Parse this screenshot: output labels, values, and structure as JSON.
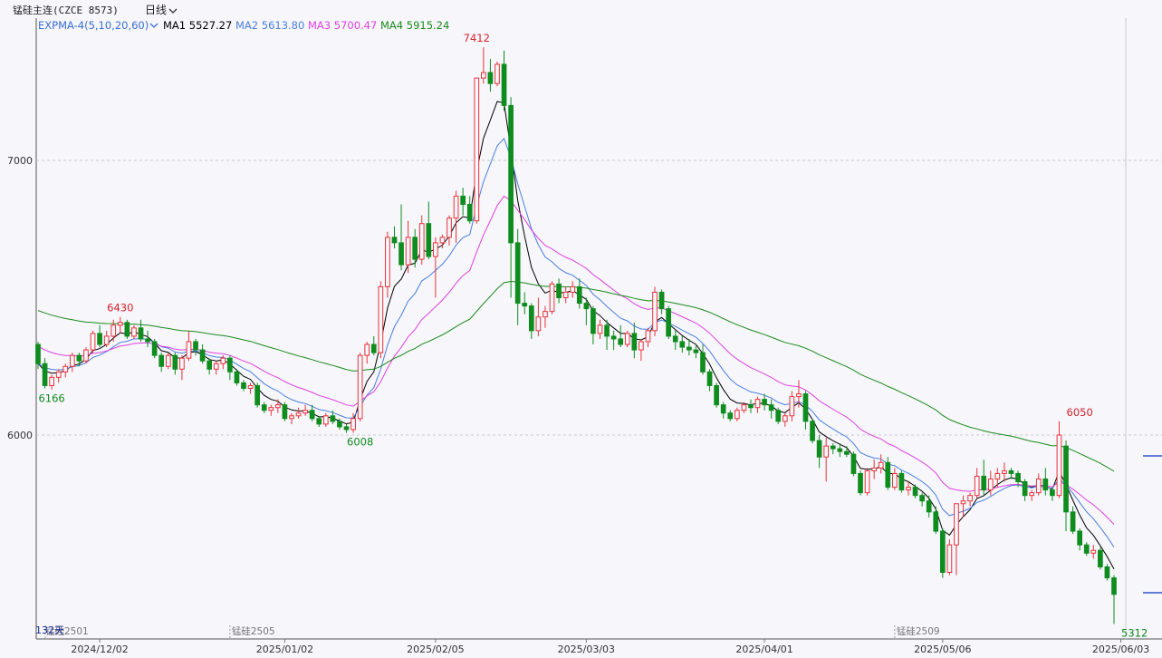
{
  "header": {
    "title": "锰硅主连(CZCE  8573)",
    "period_label": "日线",
    "chevron": "chevron-down-icon"
  },
  "legend": {
    "indicator": "EXPMA-4(5,10,20,60)",
    "ma1": "MA1 5527.27",
    "ma2": "MA2 5613.80",
    "ma3": "MA3 5700.47",
    "ma4": "MA4 5915.24"
  },
  "colors": {
    "background": "#f6f6fb",
    "up": "#e8333a",
    "down": "#0f8c1e",
    "ma1": "#000000",
    "ma2": "#4a7fe0",
    "ma3": "#e040e0",
    "ma4": "#1a8a1a",
    "grid": "#c8c8d0"
  },
  "chart_data": {
    "type": "candlestick",
    "y_ticks": [
      "7000",
      "6000"
    ],
    "y_tick_values": [
      7000,
      6000
    ],
    "ylim": [
      5260,
      7580
    ],
    "x_labels": [
      "2024/12/02",
      "2025/01/02",
      "2025/02/05",
      "2025/03/03",
      "2025/04/01",
      "2025/05/06",
      "2025/06/03"
    ],
    "x_label_index": [
      9,
      36,
      58,
      80,
      106,
      132,
      158
    ],
    "contract_labels": [
      "锰硅2501",
      "锰硅2505",
      "锰硅2509"
    ],
    "contract_label_index": [
      0,
      28,
      125
    ],
    "day_count": "132天",
    "annotations": [
      {
        "text": "6430",
        "index": 12,
        "value": 6430,
        "kind": "high"
      },
      {
        "text": "6166",
        "index": 2,
        "value": 6166,
        "kind": "low"
      },
      {
        "text": "6008",
        "index": 47,
        "value": 6008,
        "kind": "low"
      },
      {
        "text": "7412",
        "index": 64,
        "value": 7412,
        "kind": "high"
      },
      {
        "text": "6050",
        "index": 152,
        "value": 6050,
        "kind": "high"
      },
      {
        "text": "5312",
        "index": 160,
        "value": 5312,
        "kind": "low"
      }
    ],
    "ohlc": [
      [
        6330,
        6340,
        6240,
        6260
      ],
      [
        6260,
        6280,
        6170,
        6180
      ],
      [
        6180,
        6220,
        6166,
        6210
      ],
      [
        6210,
        6240,
        6190,
        6230
      ],
      [
        6230,
        6260,
        6210,
        6250
      ],
      [
        6250,
        6300,
        6230,
        6290
      ],
      [
        6290,
        6300,
        6250,
        6270
      ],
      [
        6270,
        6320,
        6260,
        6310
      ],
      [
        6310,
        6380,
        6300,
        6370
      ],
      [
        6370,
        6400,
        6320,
        6330
      ],
      [
        6330,
        6380,
        6320,
        6360
      ],
      [
        6360,
        6420,
        6340,
        6400
      ],
      [
        6400,
        6430,
        6370,
        6410
      ],
      [
        6410,
        6420,
        6350,
        6360
      ],
      [
        6360,
        6400,
        6350,
        6390
      ],
      [
        6390,
        6420,
        6340,
        6350
      ],
      [
        6350,
        6380,
        6320,
        6340
      ],
      [
        6340,
        6350,
        6280,
        6290
      ],
      [
        6290,
        6300,
        6230,
        6250
      ],
      [
        6250,
        6300,
        6240,
        6290
      ],
      [
        6290,
        6300,
        6220,
        6240
      ],
      [
        6240,
        6290,
        6200,
        6280
      ],
      [
        6280,
        6380,
        6270,
        6340
      ],
      [
        6340,
        6350,
        6290,
        6310
      ],
      [
        6310,
        6330,
        6260,
        6270
      ],
      [
        6270,
        6280,
        6220,
        6240
      ],
      [
        6240,
        6270,
        6220,
        6260
      ],
      [
        6260,
        6290,
        6240,
        6280
      ],
      [
        6280,
        6290,
        6200,
        6230
      ],
      [
        6230,
        6240,
        6180,
        6190
      ],
      [
        6190,
        6200,
        6160,
        6170
      ],
      [
        6170,
        6190,
        6150,
        6180
      ],
      [
        6180,
        6190,
        6100,
        6110
      ],
      [
        6110,
        6120,
        6080,
        6090
      ],
      [
        6090,
        6110,
        6070,
        6100
      ],
      [
        6100,
        6130,
        6080,
        6110
      ],
      [
        6110,
        6120,
        6050,
        6060
      ],
      [
        6060,
        6080,
        6040,
        6070
      ],
      [
        6070,
        6100,
        6060,
        6080
      ],
      [
        6080,
        6110,
        6070,
        6090
      ],
      [
        6090,
        6110,
        6050,
        6060
      ],
      [
        6060,
        6070,
        6030,
        6040
      ],
      [
        6040,
        6080,
        6030,
        6070
      ],
      [
        6070,
        6090,
        6040,
        6050
      ],
      [
        6050,
        6060,
        6020,
        6030
      ],
      [
        6030,
        6040,
        6008,
        6020
      ],
      [
        6020,
        6080,
        6008,
        6060
      ],
      [
        6060,
        6300,
        6050,
        6290
      ],
      [
        6290,
        6340,
        6260,
        6330
      ],
      [
        6330,
        6360,
        6290,
        6300
      ],
      [
        6300,
        6560,
        6280,
        6540
      ],
      [
        6540,
        6740,
        6500,
        6720
      ],
      [
        6720,
        6760,
        6680,
        6700
      ],
      [
        6700,
        6840,
        6600,
        6620
      ],
      [
        6620,
        6780,
        6590,
        6720
      ],
      [
        6720,
        6750,
        6610,
        6640
      ],
      [
        6640,
        6800,
        6620,
        6770
      ],
      [
        6770,
        6850,
        6640,
        6650
      ],
      [
        6650,
        6720,
        6500,
        6700
      ],
      [
        6700,
        6730,
        6680,
        6720
      ],
      [
        6720,
        6800,
        6690,
        6790
      ],
      [
        6790,
        6890,
        6700,
        6870
      ],
      [
        6870,
        6900,
        6800,
        6840
      ],
      [
        6840,
        6870,
        6770,
        6780
      ],
      [
        6780,
        7300,
        6770,
        7300
      ],
      [
        7300,
        7412,
        7280,
        7320
      ],
      [
        7320,
        7370,
        7250,
        7280
      ],
      [
        7280,
        7360,
        7270,
        7350
      ],
      [
        7350,
        7400,
        7180,
        7200
      ],
      [
        7200,
        7230,
        6500,
        6700
      ],
      [
        6700,
        6750,
        6400,
        6480
      ],
      [
        6480,
        6520,
        6440,
        6470
      ],
      [
        6470,
        6480,
        6350,
        6380
      ],
      [
        6380,
        6500,
        6360,
        6430
      ],
      [
        6430,
        6470,
        6390,
        6450
      ],
      [
        6450,
        6560,
        6440,
        6550
      ],
      [
        6550,
        6570,
        6480,
        6500
      ],
      [
        6500,
        6540,
        6480,
        6520
      ],
      [
        6520,
        6560,
        6500,
        6540
      ],
      [
        6540,
        6570,
        6460,
        6480
      ],
      [
        6480,
        6500,
        6400,
        6460
      ],
      [
        6460,
        6470,
        6330,
        6370
      ],
      [
        6370,
        6420,
        6350,
        6400
      ],
      [
        6400,
        6420,
        6310,
        6360
      ],
      [
        6360,
        6380,
        6310,
        6350
      ],
      [
        6350,
        6400,
        6320,
        6330
      ],
      [
        6330,
        6380,
        6320,
        6370
      ],
      [
        6370,
        6410,
        6280,
        6310
      ],
      [
        6310,
        6350,
        6270,
        6340
      ],
      [
        6340,
        6390,
        6320,
        6380
      ],
      [
        6380,
        6540,
        6360,
        6520
      ],
      [
        6520,
        6530,
        6440,
        6460
      ],
      [
        6460,
        6470,
        6350,
        6360
      ],
      [
        6360,
        6380,
        6310,
        6340
      ],
      [
        6340,
        6360,
        6300,
        6320
      ],
      [
        6320,
        6350,
        6290,
        6310
      ],
      [
        6310,
        6330,
        6280,
        6300
      ],
      [
        6300,
        6330,
        6220,
        6230
      ],
      [
        6230,
        6240,
        6160,
        6180
      ],
      [
        6180,
        6190,
        6100,
        6110
      ],
      [
        6110,
        6120,
        6060,
        6080
      ],
      [
        6080,
        6090,
        6050,
        6060
      ],
      [
        6060,
        6100,
        6050,
        6090
      ],
      [
        6090,
        6120,
        6080,
        6110
      ],
      [
        6110,
        6130,
        6080,
        6100
      ],
      [
        6100,
        6140,
        6080,
        6130
      ],
      [
        6130,
        6150,
        6090,
        6110
      ],
      [
        6110,
        6130,
        6060,
        6090
      ],
      [
        6090,
        6100,
        6040,
        6050
      ],
      [
        6050,
        6080,
        6030,
        6070
      ],
      [
        6070,
        6160,
        6050,
        6140
      ],
      [
        6140,
        6200,
        6100,
        6150
      ],
      [
        6150,
        6160,
        6020,
        6050
      ],
      [
        6050,
        6060,
        5970,
        5980
      ],
      [
        5980,
        6000,
        5880,
        5920
      ],
      [
        5920,
        5990,
        5830,
        5960
      ],
      [
        5960,
        5970,
        5930,
        5950
      ],
      [
        5950,
        5970,
        5920,
        5940
      ],
      [
        5940,
        5960,
        5920,
        5930
      ],
      [
        5930,
        5940,
        5850,
        5860
      ],
      [
        5860,
        5870,
        5780,
        5790
      ],
      [
        5790,
        5880,
        5780,
        5870
      ],
      [
        5870,
        5910,
        5840,
        5880
      ],
      [
        5880,
        5930,
        5860,
        5900
      ],
      [
        5900,
        5920,
        5800,
        5810
      ],
      [
        5810,
        5880,
        5800,
        5860
      ],
      [
        5860,
        5870,
        5790,
        5800
      ],
      [
        5800,
        5830,
        5780,
        5810
      ],
      [
        5810,
        5820,
        5770,
        5780
      ],
      [
        5780,
        5790,
        5740,
        5760
      ],
      [
        5760,
        5780,
        5700,
        5720
      ],
      [
        5720,
        5740,
        5640,
        5650
      ],
      [
        5650,
        5660,
        5480,
        5500
      ],
      [
        5500,
        5620,
        5490,
        5600
      ],
      [
        5600,
        5740,
        5490,
        5750
      ],
      [
        5750,
        5780,
        5700,
        5760
      ],
      [
        5760,
        5790,
        5740,
        5780
      ],
      [
        5780,
        5880,
        5770,
        5850
      ],
      [
        5850,
        5910,
        5780,
        5800
      ],
      [
        5800,
        5870,
        5780,
        5840
      ],
      [
        5840,
        5880,
        5810,
        5860
      ],
      [
        5860,
        5900,
        5830,
        5870
      ],
      [
        5870,
        5880,
        5840,
        5860
      ],
      [
        5860,
        5870,
        5810,
        5830
      ],
      [
        5830,
        5840,
        5760,
        5780
      ],
      [
        5780,
        5800,
        5760,
        5790
      ],
      [
        5790,
        5860,
        5780,
        5840
      ],
      [
        5840,
        5880,
        5780,
        5800
      ],
      [
        5800,
        5810,
        5760,
        5780
      ],
      [
        5780,
        6050,
        5770,
        6000
      ],
      [
        5960,
        5980,
        5650,
        5720
      ],
      [
        5720,
        5740,
        5640,
        5650
      ],
      [
        5650,
        5660,
        5580,
        5600
      ],
      [
        5600,
        5610,
        5560,
        5570
      ],
      [
        5570,
        5600,
        5550,
        5580
      ],
      [
        5580,
        5590,
        5510,
        5520
      ],
      [
        5520,
        5530,
        5470,
        5480
      ],
      [
        5480,
        5490,
        5312,
        5420
      ]
    ]
  }
}
